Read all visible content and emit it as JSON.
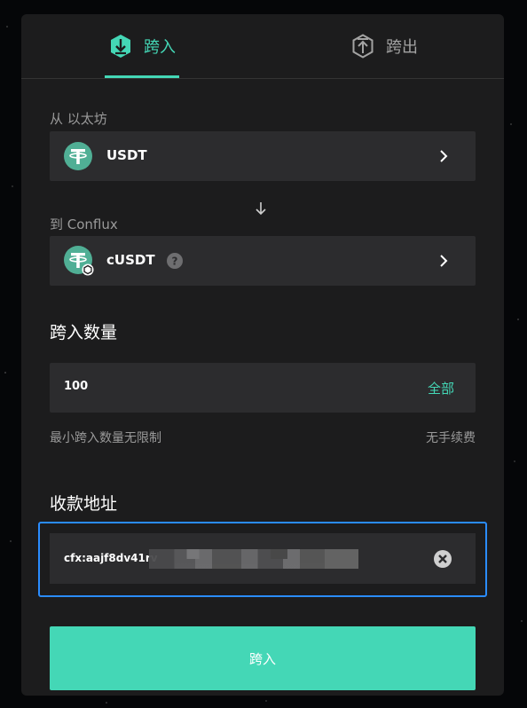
{
  "tabs": [
    {
      "label": "跨入",
      "icon": "arrow-in-icon",
      "active": true
    },
    {
      "label": "跨出",
      "icon": "arrow-out-icon",
      "active": false
    }
  ],
  "from": {
    "label": "从 以太坊",
    "token": "USDT"
  },
  "to": {
    "label": "到 Conflux",
    "token": "cUSDT"
  },
  "amount": {
    "title": "跨入数量",
    "value": "100",
    "max_label": "全部",
    "min_hint": "最小跨入数量无限制",
    "fee_hint": "无手续费"
  },
  "address": {
    "title": "收款地址",
    "value": "cfx:aajf8dv41rv"
  },
  "submit_label": "跨入",
  "colors": {
    "accent": "#44d7b6",
    "background": "#1c1c1d",
    "field": "#2c2c2e",
    "focus": "#2a8cff"
  }
}
